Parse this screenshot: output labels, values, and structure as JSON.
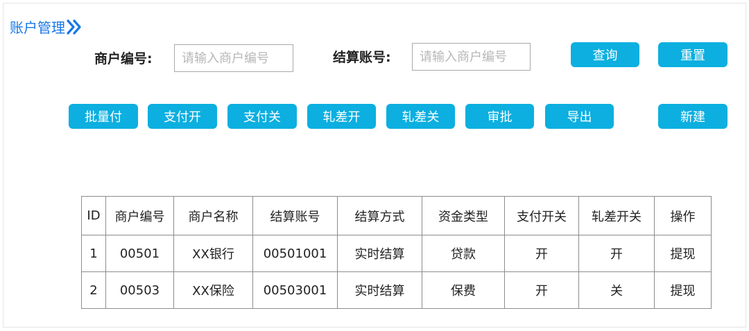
{
  "breadcrumb": {
    "title": "账户管理",
    "icon": "double-chevron-right-icon"
  },
  "search": {
    "merchant_label": "商户编号:",
    "merchant_placeholder": "请输入商户编号",
    "merchant_value": "",
    "account_label": "结算账号:",
    "account_placeholder": "请输入商户编号",
    "account_value": "",
    "query_label": "查询",
    "reset_label": "重置"
  },
  "toolbar": {
    "batch_pay": "批量付",
    "pay_on": "支付开",
    "pay_off": "支付关",
    "diff_on": "轧差开",
    "diff_off": "轧差关",
    "approve": "审批",
    "export": "导出",
    "create": "新建"
  },
  "table": {
    "headers": [
      "ID",
      "商户编号",
      "商户名称",
      "结算账号",
      "结算方式",
      "资金类型",
      "支付开关",
      "轧差开关",
      "操作"
    ],
    "rows": [
      [
        "1",
        "00501",
        "XX银行",
        "00501001",
        "实时结算",
        "贷款",
        "开",
        "开",
        "提现"
      ],
      [
        "2",
        "00503",
        "XX保险",
        "00503001",
        "实时结算",
        "保费",
        "开",
        "关",
        "提现"
      ]
    ]
  },
  "colors": {
    "accent": "#0cafe0",
    "link": "#1677e8",
    "border": "#8c8c8c"
  }
}
